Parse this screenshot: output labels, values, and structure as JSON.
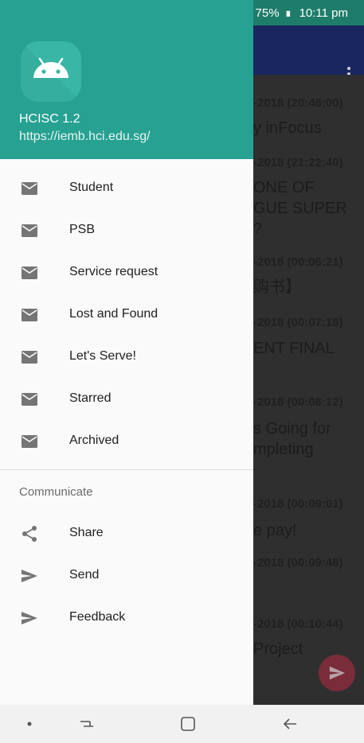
{
  "status_bar": {
    "battery": "75%",
    "time": "10:11 pm"
  },
  "drawer": {
    "app_name": "HCISC 1.2",
    "app_url": "https://iemb.hci.edu.sg/",
    "items": [
      {
        "label": "Student",
        "icon": "mail-icon"
      },
      {
        "label": "PSB",
        "icon": "mail-icon"
      },
      {
        "label": "Service request",
        "icon": "mail-icon"
      },
      {
        "label": "Lost and Found",
        "icon": "mail-icon"
      },
      {
        "label": "Let's Serve!",
        "icon": "mail-icon"
      },
      {
        "label": "Starred",
        "icon": "mail-icon"
      },
      {
        "label": "Archived",
        "icon": "mail-icon"
      }
    ],
    "section_title": "Communicate",
    "communicate": [
      {
        "label": "Share",
        "icon": "share-icon"
      },
      {
        "label": "Send",
        "icon": "send-icon"
      },
      {
        "label": "Feedback",
        "icon": "send-icon"
      }
    ]
  },
  "background_list": [
    {
      "date": "-2018 (20:46:00)",
      "title": "y inFocus"
    },
    {
      "date": "-2018 (21:22:40)",
      "title": "ONE OF"
    },
    {
      "date": "",
      "title": "GUE SUPER"
    },
    {
      "date": "",
      "title": "?"
    },
    {
      "date": "-2018 (00:06:21)",
      "title": "购书】"
    },
    {
      "date": "-2018 (00:07:18)",
      "title": "ENT FINAL"
    },
    {
      "date": "-2018 (00:08:12)",
      "title": "s Going for"
    },
    {
      "date": "",
      "title": "mpleting"
    },
    {
      "date": "-2018 (00:09:01)",
      "title": "e pay!"
    },
    {
      "date": "-2018 (00:09:48)",
      "title": ""
    },
    {
      "date": "-2018 (00:10:44)",
      "title": "Project"
    }
  ],
  "colors": {
    "header": "#26a192",
    "status_bar": "#1e7c6a",
    "toolbar": "#1a2660",
    "fab": "#c2384f"
  }
}
